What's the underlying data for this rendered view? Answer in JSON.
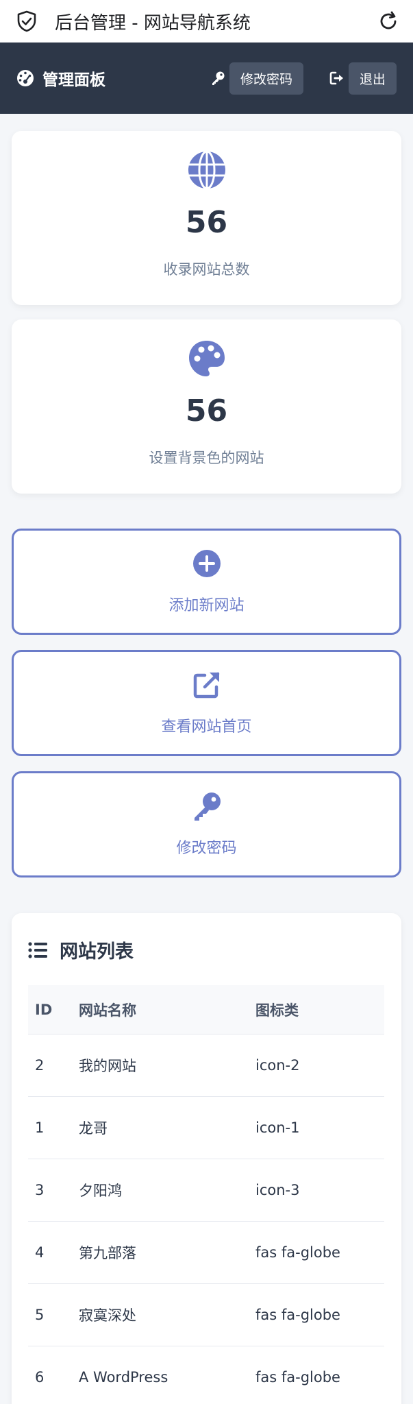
{
  "browser": {
    "title": "后台管理 - 网站导航系统",
    "icons": {
      "left": "shield-check-icon",
      "right": "reload-icon"
    }
  },
  "header": {
    "brand": "管理面板",
    "brand_icon": "dashboard-icon",
    "change_password_label": "修改密码",
    "logout_label": "退出"
  },
  "stats": [
    {
      "value": "56",
      "label": "收录网站总数",
      "icon": "globe-icon"
    },
    {
      "value": "56",
      "label": "设置背景色的网站",
      "icon": "palette-icon"
    }
  ],
  "actions": [
    {
      "label": "添加新网站",
      "icon": "plus-circle-icon"
    },
    {
      "label": "查看网站首页",
      "icon": "external-link-icon"
    },
    {
      "label": "修改密码",
      "icon": "key-icon"
    }
  ],
  "site_list": {
    "title": "网站列表",
    "columns": [
      "ID",
      "网站名称",
      "图标类"
    ],
    "rows": [
      [
        "2",
        "我的网站",
        "icon-2"
      ],
      [
        "1",
        "龙哥",
        "icon-1"
      ],
      [
        "3",
        "夕阳鸿",
        "icon-3"
      ],
      [
        "4",
        "第九部落",
        "fas fa-globe"
      ],
      [
        "5",
        "寂寞深处",
        "fas fa-globe"
      ],
      [
        "6",
        "A WordPress",
        "fas fa-globe"
      ]
    ]
  },
  "colors": {
    "header_bg": "#2d3748",
    "accent": "#6b7cc9",
    "page_bg": "#f4f6f9"
  }
}
